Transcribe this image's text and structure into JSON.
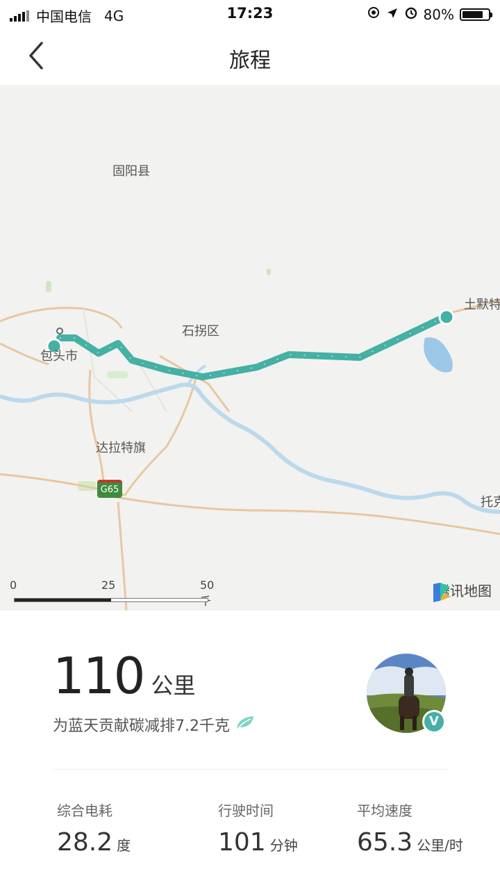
{
  "status_bar": {
    "carrier": "中国电信",
    "network": "4G",
    "time": "17:23",
    "battery_percent": "80%",
    "battery_level": 0.8
  },
  "nav": {
    "title": "旅程",
    "back_icon": "chevron-left-icon"
  },
  "map": {
    "places": {
      "guyang": "固阳县",
      "baotou": "包头市",
      "shiguai": "石拐区",
      "dalate": "达拉特旗",
      "tumote": "土默特",
      "tuoke": "托克"
    },
    "road_shield": "G65",
    "scale": {
      "zero": "0",
      "mid": "25",
      "end": "50 千米"
    },
    "brand": "腾讯地图",
    "colors": {
      "route": "#45b0a4",
      "river": "#bcd9ec",
      "road": "#e8c7a0",
      "lake": "#9cc8e8"
    }
  },
  "summary": {
    "distance_value": "110",
    "distance_unit": "公里",
    "carbon_text": "为蓝天贡献碳减排7.2千克",
    "leaf_icon": "leaf-icon",
    "verified_badge": "V",
    "stats": [
      {
        "label": "综合电耗",
        "value": "28.2",
        "unit": "度"
      },
      {
        "label": "行驶时间",
        "value": "101",
        "unit": "分钟"
      },
      {
        "label": "平均速度",
        "value": "65.3",
        "unit": "公里/时"
      }
    ]
  }
}
